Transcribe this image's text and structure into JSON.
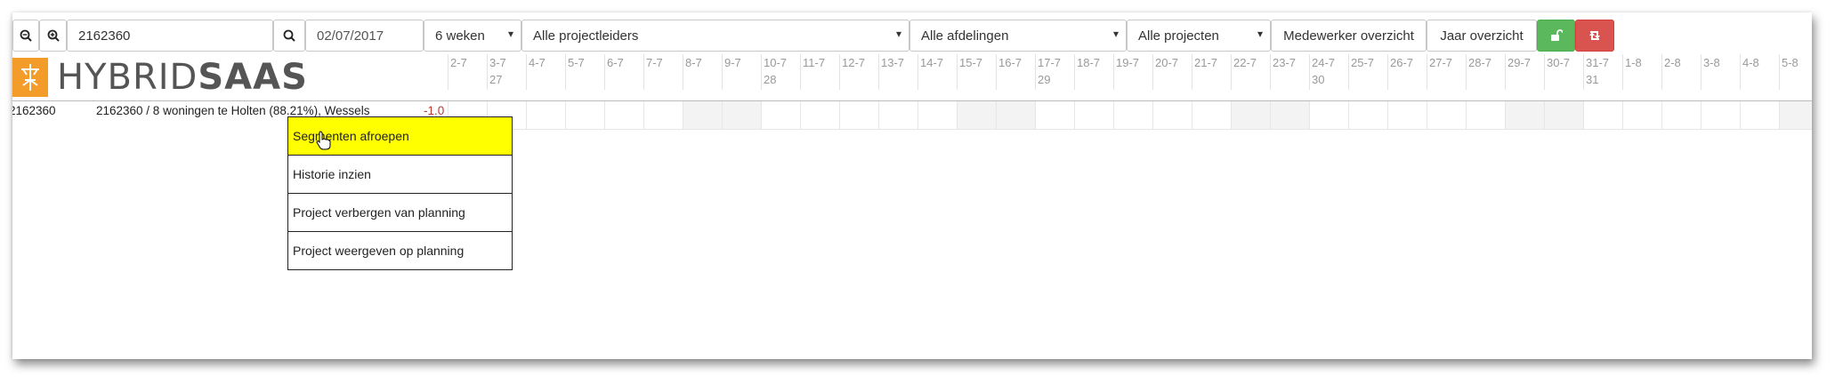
{
  "toolbar": {
    "search_value": "2162360",
    "date_value": "02/07/2017",
    "period_selected": "6 weken",
    "projectleaders_selected": "Alle projectleiders",
    "departments_selected": "Alle afdelingen",
    "projects_selected": "Alle projecten",
    "employee_overview_label": "Medewerker overzicht",
    "year_overview_label": "Jaar overzicht"
  },
  "logo": {
    "part1": "HYBRID",
    "part2": "SAAS"
  },
  "timeline": {
    "days": [
      "2-7",
      "3-7",
      "4-7",
      "5-7",
      "6-7",
      "7-7",
      "8-7",
      "9-7",
      "10-7",
      "11-7",
      "12-7",
      "13-7",
      "14-7",
      "15-7",
      "16-7",
      "17-7",
      "18-7",
      "19-7",
      "20-7",
      "21-7",
      "22-7",
      "23-7",
      "24-7",
      "25-7",
      "26-7",
      "27-7",
      "28-7",
      "29-7",
      "30-7",
      "31-7",
      "1-8",
      "2-8",
      "3-8",
      "4-8",
      "5-8"
    ],
    "weeks": [
      {
        "day_index": 1,
        "label": "27"
      },
      {
        "day_index": 8,
        "label": "28"
      },
      {
        "day_index": 15,
        "label": "29"
      },
      {
        "day_index": 22,
        "label": "30"
      },
      {
        "day_index": 29,
        "label": "31"
      }
    ],
    "weekend_indices": [
      6,
      7,
      13,
      14,
      20,
      21,
      27,
      28,
      34
    ]
  },
  "row": {
    "id": "2162360",
    "description": "2162360 / 8 woningen te Holten (88.21%), Wessels",
    "value": "-1.0"
  },
  "context_menu": {
    "items": [
      "Segmenten afroepen",
      "Historie inzien",
      "Project verbergen van planning",
      "Project weergeven op planning"
    ]
  },
  "colors": {
    "highlight": "#ffff00",
    "unlock_button": "#5cb85c",
    "sync_button": "#d9534f",
    "logo_orange": "#f39c2a",
    "negative_value": "#c0392b"
  }
}
